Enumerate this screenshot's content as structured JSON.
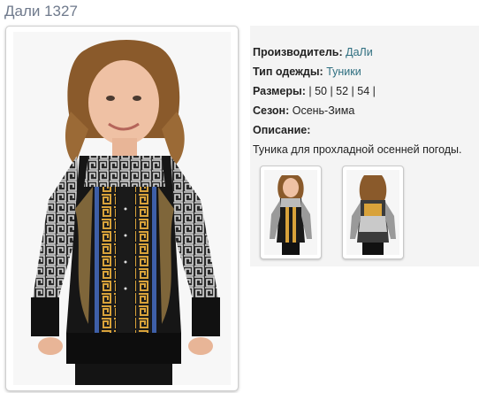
{
  "product": {
    "title": "Дали 1327"
  },
  "details": {
    "manufacturer_label": "Производитель:",
    "manufacturer_value": "ДаЛи",
    "type_label": "Тип одежды:",
    "type_value": "Туники",
    "sizes_label": "Размеры:",
    "sizes_value": "| 50 | 52 | 54 |",
    "season_label": "Сезон:",
    "season_value": "Осень-Зима",
    "description_label": "Описание:",
    "description_text": "Туника для прохладной осенней погоды."
  },
  "thumbnails": [
    {
      "icon": "tunic-front-photo"
    },
    {
      "icon": "tunic-back-photo"
    }
  ],
  "colors": {
    "link": "#2f6f80",
    "title": "#6f7a8c",
    "panel_bg": "#f4f4f4"
  }
}
